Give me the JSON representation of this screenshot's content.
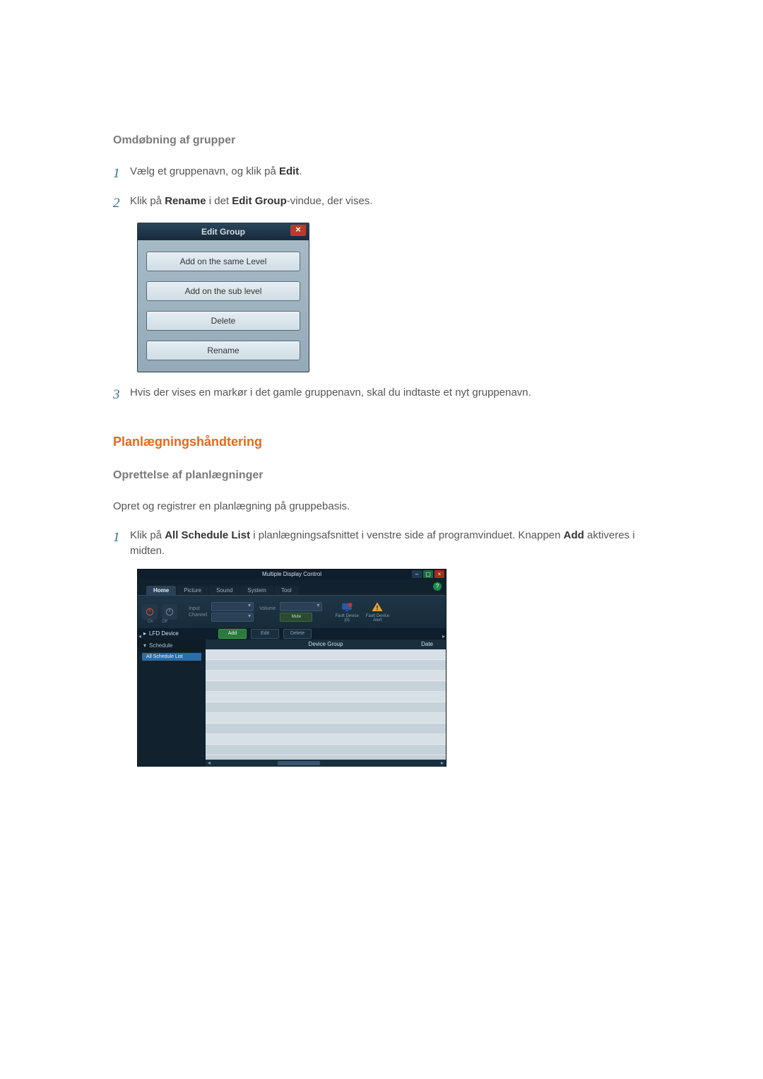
{
  "section1": {
    "heading": "Omdøbning af grupper",
    "steps": [
      {
        "num": "1",
        "pre": "Vælg et gruppenavn, og klik på ",
        "b1": "Edit",
        "post": "."
      },
      {
        "num": "2",
        "pre": "Klik på ",
        "b1": "Rename",
        "mid": " i det ",
        "b2": "Edit Group",
        "post": "-vindue, der vises."
      },
      {
        "num": "3",
        "pre": "Hvis der vises en markør i det gamle gruppenavn, skal du indtaste et nyt gruppenavn."
      }
    ]
  },
  "editGroupDialog": {
    "title": "Edit Group",
    "close": "×",
    "buttons": [
      "Add on the same Level",
      "Add on the sub level",
      "Delete",
      "Rename"
    ]
  },
  "section2": {
    "h2": "Planlægningshåndtering",
    "h3": "Oprettelse af planlægninger",
    "para": "Opret og registrer en planlægning på gruppebasis.",
    "step1": {
      "num": "1",
      "pre": "Klik på ",
      "b1": "All Schedule List",
      "mid": " i planlægningsafsnittet i venstre side af programvinduet. Knappen ",
      "b2": "Add",
      "post": " aktiveres i midten."
    }
  },
  "app": {
    "title": "Multiple Display Control",
    "tabs": [
      "Home",
      "Picture",
      "Sound",
      "System",
      "Tool"
    ],
    "help": "?",
    "power": {
      "on": "On",
      "off": "Off"
    },
    "inputLabel": "Input",
    "channelLabel": "Channel",
    "volumeLabel": "Volume",
    "muteLabel": "Mute",
    "fault1a": "Fault Device",
    "fault1b": "(0)",
    "fault2a": "Fault Device",
    "fault2b": "Alert",
    "midLeft": "LFD Device",
    "toolbar": {
      "add": "Add",
      "edit": "Edit",
      "delete": "Delete"
    },
    "sidebar": {
      "schedule": "Schedule",
      "allSchedule": "All Schedule List"
    },
    "contentHeader": {
      "group": "Device Group",
      "date": "Date"
    }
  }
}
